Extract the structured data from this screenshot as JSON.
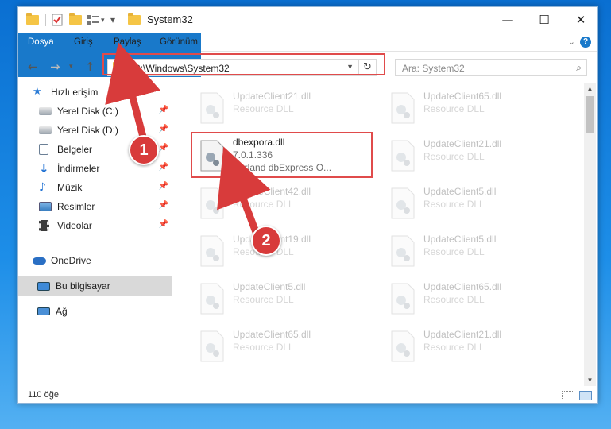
{
  "window": {
    "title": "System32",
    "controls": {
      "minimize": "—",
      "maximize": "☐",
      "close": "✕"
    }
  },
  "ribbon": {
    "tabs": [
      "Dosya",
      "Giriş",
      "Paylaş",
      "Görünüm"
    ],
    "help": "?"
  },
  "address_bar": {
    "path": "C:\\Windows\\System32",
    "search_placeholder": "Ara: System32"
  },
  "sidebar": {
    "quick_access": "Hızlı erişim",
    "items": [
      {
        "label": "Yerel Disk (C:)",
        "icon": "drive-icon",
        "pinned": true
      },
      {
        "label": "Yerel Disk (D:)",
        "icon": "drive-icon",
        "pinned": true
      },
      {
        "label": "Belgeler",
        "icon": "documents-icon",
        "pinned": true
      },
      {
        "label": "İndirmeler",
        "icon": "downloads-icon",
        "pinned": true
      },
      {
        "label": "Müzik",
        "icon": "music-icon",
        "pinned": true
      },
      {
        "label": "Resimler",
        "icon": "pictures-icon",
        "pinned": true
      },
      {
        "label": "Videolar",
        "icon": "videos-icon",
        "pinned": true
      }
    ],
    "onedrive": "OneDrive",
    "this_pc": "Bu bilgisayar",
    "network": "Ağ"
  },
  "files": {
    "left": [
      {
        "name": "UpdateClient21.dll",
        "type": "Resource DLL",
        "faded": true
      },
      {
        "name": "dbexpora.dll",
        "type": "7.0.1.336",
        "desc": "Borland dbExpress O...",
        "faded": false
      },
      {
        "name": "UpdateClient42.dll",
        "type": "Resource DLL",
        "faded": true
      },
      {
        "name": "UpdateClient19.dll",
        "type": "Resource DLL",
        "faded": true
      },
      {
        "name": "UpdateClient5.dll",
        "type": "Resource DLL",
        "faded": true
      },
      {
        "name": "UpdateClient65.dll",
        "type": "Resource DLL",
        "faded": true
      }
    ],
    "right": [
      {
        "name": "UpdateClient65.dll",
        "type": "Resource DLL"
      },
      {
        "name": "UpdateClient21.dll",
        "type": "Resource DLL"
      },
      {
        "name": "UpdateClient5.dll",
        "type": "Resource DLL"
      },
      {
        "name": "UpdateClient5.dll",
        "type": "Resource DLL"
      },
      {
        "name": "UpdateClient65.dll",
        "type": "Resource DLL"
      },
      {
        "name": "UpdateClient21.dll",
        "type": "Resource DLL"
      }
    ]
  },
  "status_bar": {
    "item_count": "110 öğe"
  },
  "annotations": {
    "step1": "1",
    "step2": "2",
    "color": "#d83b3b"
  }
}
